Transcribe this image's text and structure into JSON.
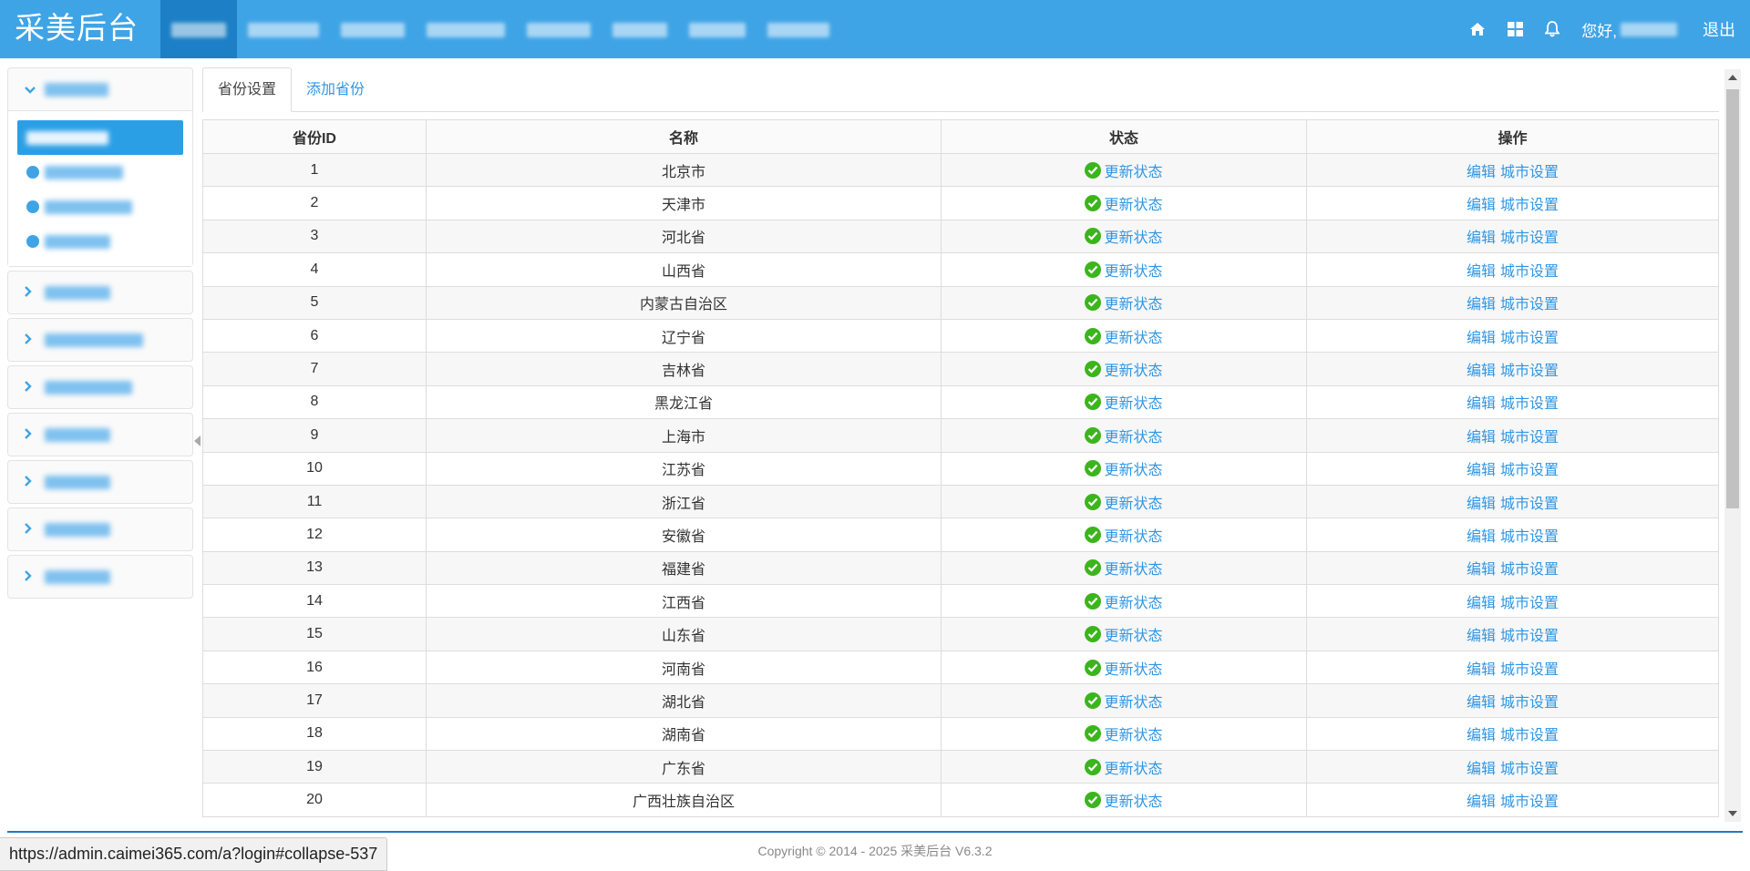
{
  "header": {
    "brand": "采美后台",
    "greeting": "您好,",
    "logout": "退出",
    "icons": [
      "home-icon",
      "grid-icon",
      "bell-icon"
    ],
    "colors": {
      "bar": "#3fa4e6",
      "active": "#1d7fc5"
    }
  },
  "tabs": [
    {
      "label": "省份设置",
      "active": true
    },
    {
      "label": "添加省份",
      "active": false
    }
  ],
  "table": {
    "headers": [
      "省份ID",
      "名称",
      "状态",
      "操作"
    ],
    "rows": [
      {
        "id": "1",
        "name": "北京市"
      },
      {
        "id": "2",
        "name": "天津市"
      },
      {
        "id": "3",
        "name": "河北省"
      },
      {
        "id": "4",
        "name": "山西省"
      },
      {
        "id": "5",
        "name": "内蒙古自治区"
      },
      {
        "id": "6",
        "name": "辽宁省"
      },
      {
        "id": "7",
        "name": "吉林省"
      },
      {
        "id": "8",
        "name": "黑龙江省"
      },
      {
        "id": "9",
        "name": "上海市"
      },
      {
        "id": "10",
        "name": "江苏省"
      },
      {
        "id": "11",
        "name": "浙江省"
      },
      {
        "id": "12",
        "name": "安徽省"
      },
      {
        "id": "13",
        "name": "福建省"
      },
      {
        "id": "14",
        "name": "江西省"
      },
      {
        "id": "15",
        "name": "山东省"
      },
      {
        "id": "16",
        "name": "河南省"
      },
      {
        "id": "17",
        "name": "湖北省"
      },
      {
        "id": "18",
        "name": "湖南省"
      },
      {
        "id": "19",
        "name": "广东省"
      },
      {
        "id": "20",
        "name": "广西壮族自治区"
      }
    ],
    "status_label": "更新状态",
    "edit_label": "编辑",
    "city_label": "城市设置"
  },
  "footer": {
    "copyright": "Copyright © 2014 - 2025 采美后台 V6.3.2",
    "status_url": "https://admin.caimei365.com/a?login#collapse-537"
  }
}
